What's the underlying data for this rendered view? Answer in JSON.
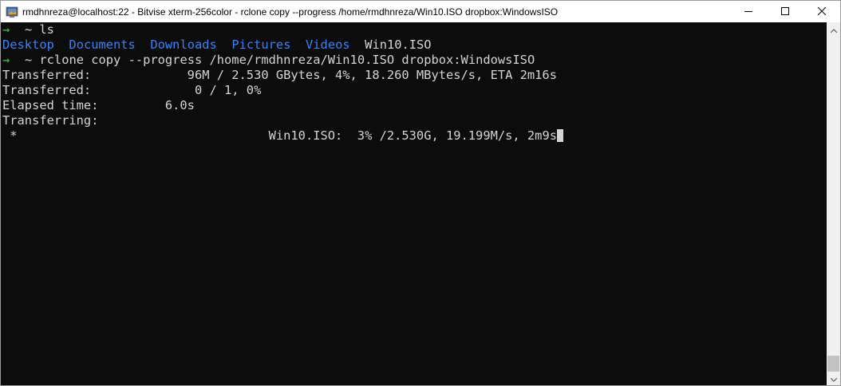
{
  "window": {
    "title": "rmdhnreza@localhost:22 - Bitvise xterm-256color - rclone copy --progress /home/rmdhnreza/Win10.ISO dropbox:WindowsISO",
    "controls": {
      "minimize": "minimize-icon",
      "maximize": "maximize-icon",
      "close": "close-icon"
    }
  },
  "terminal": {
    "prompt_symbol": "→",
    "prompt_dir": "~",
    "commands": {
      "ls": "ls",
      "rclone": "rclone copy --progress /home/rmdhnreza/Win10.ISO dropbox:WindowsISO"
    },
    "ls_output": {
      "dirs": [
        "Desktop",
        "Documents",
        "Downloads",
        "Pictures",
        "Videos"
      ],
      "files": [
        "Win10.ISO"
      ]
    },
    "rclone_output": {
      "transferred_bytes_label": "Transferred:",
      "transferred_bytes_value": "96M / 2.530 GBytes, 4%, 18.260 MBytes/s, ETA 2m16s",
      "transferred_files_label": "Transferred:",
      "transferred_files_value": "0 / 1, 0%",
      "elapsed_label": "Elapsed time:",
      "elapsed_value": "6.0s",
      "transferring_label": "Transferring:",
      "transfer_item_marker": "*",
      "transfer_item_text": "Win10.ISO:  3% /2.530G, 19.199M/s, 2m9s"
    }
  },
  "colors": {
    "background": "#0c0c0c",
    "prompt": "#3fc73f",
    "directory": "#3b82f6",
    "text": "#d4d4d4"
  }
}
